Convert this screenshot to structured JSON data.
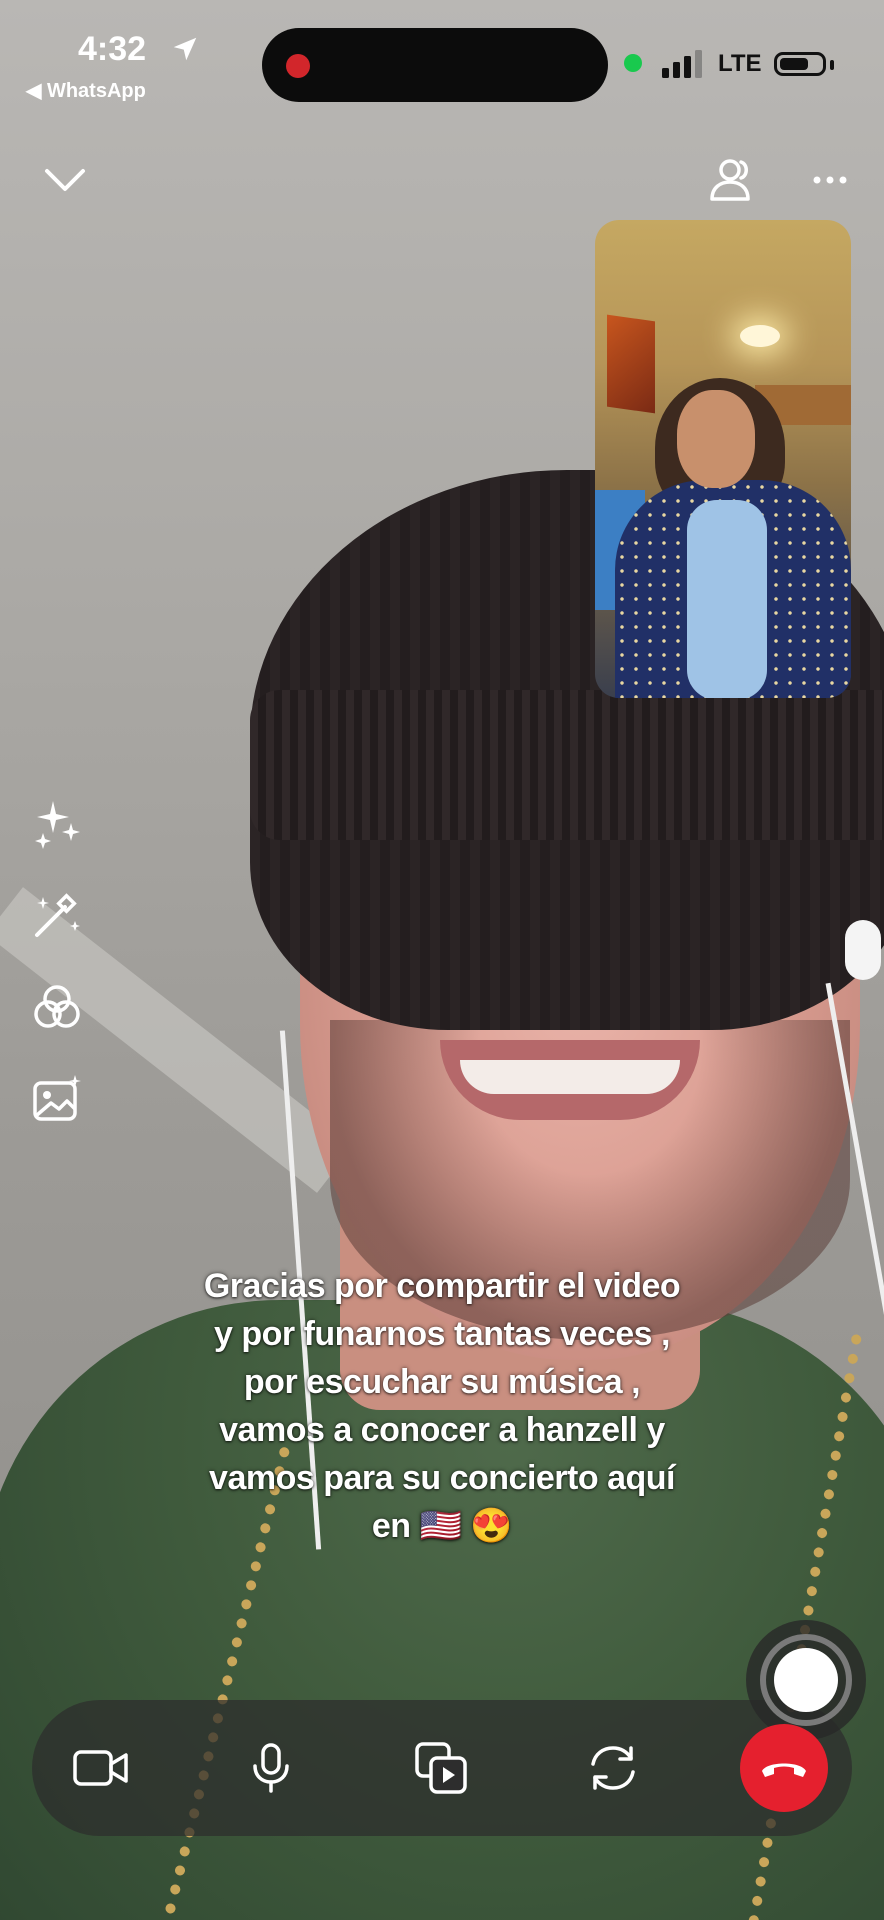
{
  "status_bar": {
    "time": "4:32",
    "back_app": "◀ WhatsApp",
    "network": "LTE",
    "recording_color": "#d2262b",
    "camera_in_use_color": "#19c94e"
  },
  "top_bar": {
    "icons": [
      "chevron-down-icon",
      "participants-icon",
      "more-icon"
    ]
  },
  "side_tools": [
    "sparkles-icon",
    "magic-wand-icon",
    "filters-icon",
    "gallery-icon"
  ],
  "caption": {
    "lines": [
      "Gracias por compartir el video",
      "y por funarnos tantas veces ,",
      "por escuchar su música ,",
      "vamos a conocer a hanzell y",
      "vamos para su concierto aquí",
      "en 🇺🇸 😍"
    ]
  },
  "call_controls": {
    "icons": [
      "video-camera-icon",
      "microphone-icon",
      "share-media-icon",
      "switch-camera-icon",
      "end-call-icon"
    ],
    "end_call_color": "#e5202e"
  }
}
